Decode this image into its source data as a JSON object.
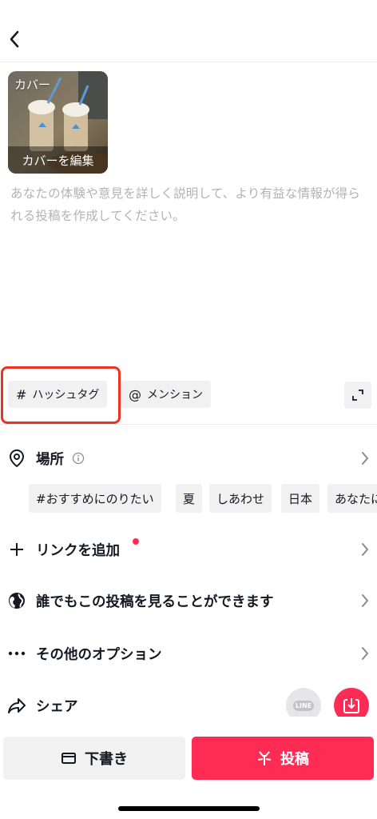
{
  "header": {
    "back_icon": "chevron-left-icon"
  },
  "cover": {
    "label": "カバー",
    "edit_label": "カバーを編集"
  },
  "description": {
    "placeholder": "あなたの体験や意見を詳しく説明して、より有益な情報が得られる投稿を作成してください。"
  },
  "chips": {
    "hashtag_symbol": "#",
    "hashtag_label": "ハッシュタグ",
    "mention_symbol": "@",
    "mention_label": "メンション",
    "expand_icon": "expand-icon"
  },
  "location": {
    "label": "場所",
    "info_icon": "info-icon",
    "suggestions": [
      "#おすすめにのりたい",
      "夏",
      "しあわせ",
      "日本",
      "あなたに"
    ]
  },
  "options": {
    "add_link": "リンクを追加",
    "visibility": "誰でもこの投稿を見ることができます",
    "more_options": "その他のオプション",
    "share": "シェア",
    "line_label": "LINE"
  },
  "colors": {
    "accent": "#fe2c55",
    "highlight_box": "#ea3323",
    "chip_bg": "#f1f1f2"
  },
  "actions": {
    "draft_label": "下書き",
    "post_label": "投稿"
  }
}
